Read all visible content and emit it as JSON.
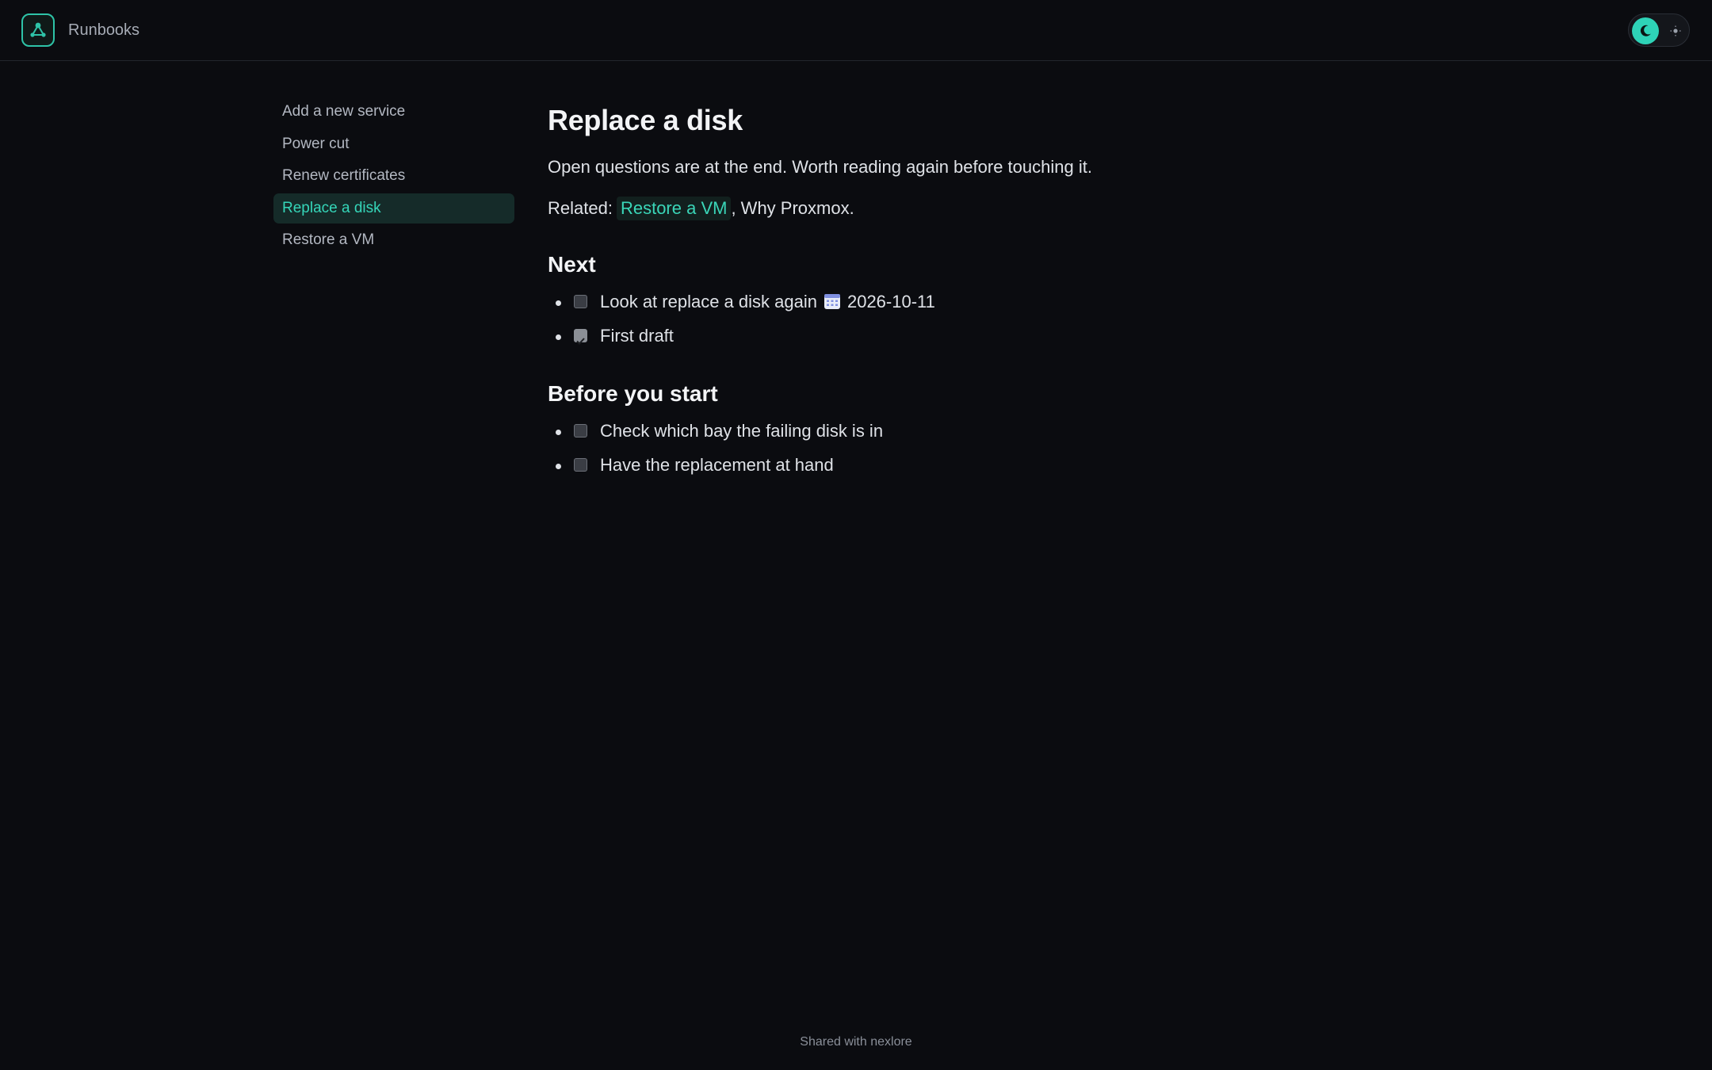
{
  "header": {
    "app_title": "Runbooks",
    "logo_icon": "network-nodes-icon",
    "theme_toggle": {
      "selected": "dark",
      "dark_icon": "moon-icon",
      "light_icon": "sun-icon"
    }
  },
  "sidebar": {
    "items": [
      {
        "label": "Add a new service",
        "active": false
      },
      {
        "label": "Power cut",
        "active": false
      },
      {
        "label": "Renew certificates",
        "active": false
      },
      {
        "label": "Replace a disk",
        "active": true
      },
      {
        "label": "Restore a VM",
        "active": false
      }
    ]
  },
  "page": {
    "title": "Replace a disk",
    "intro": "Open questions are at the end. Worth reading again before touching it.",
    "related": {
      "prefix": "Related:",
      "link_label": "Restore a VM",
      "suffix": ", Why Proxmox."
    },
    "sections": [
      {
        "heading": "Next",
        "tasks": [
          {
            "text": "Look at replace a disk again",
            "checked": false,
            "due_icon": "calendar-icon",
            "due_date": "2026-10-11"
          },
          {
            "text": "First draft",
            "checked": true
          }
        ]
      },
      {
        "heading": "Before you start",
        "tasks": [
          {
            "text": "Check which bay the failing disk is in",
            "checked": false
          },
          {
            "text": "Have the replacement at hand",
            "checked": false
          }
        ]
      }
    ]
  },
  "footer": {
    "text": "Shared with nexlore"
  },
  "colors": {
    "accent": "#2ed3b7",
    "background": "#0b0c10",
    "active_nav_bg": "#152b29"
  }
}
